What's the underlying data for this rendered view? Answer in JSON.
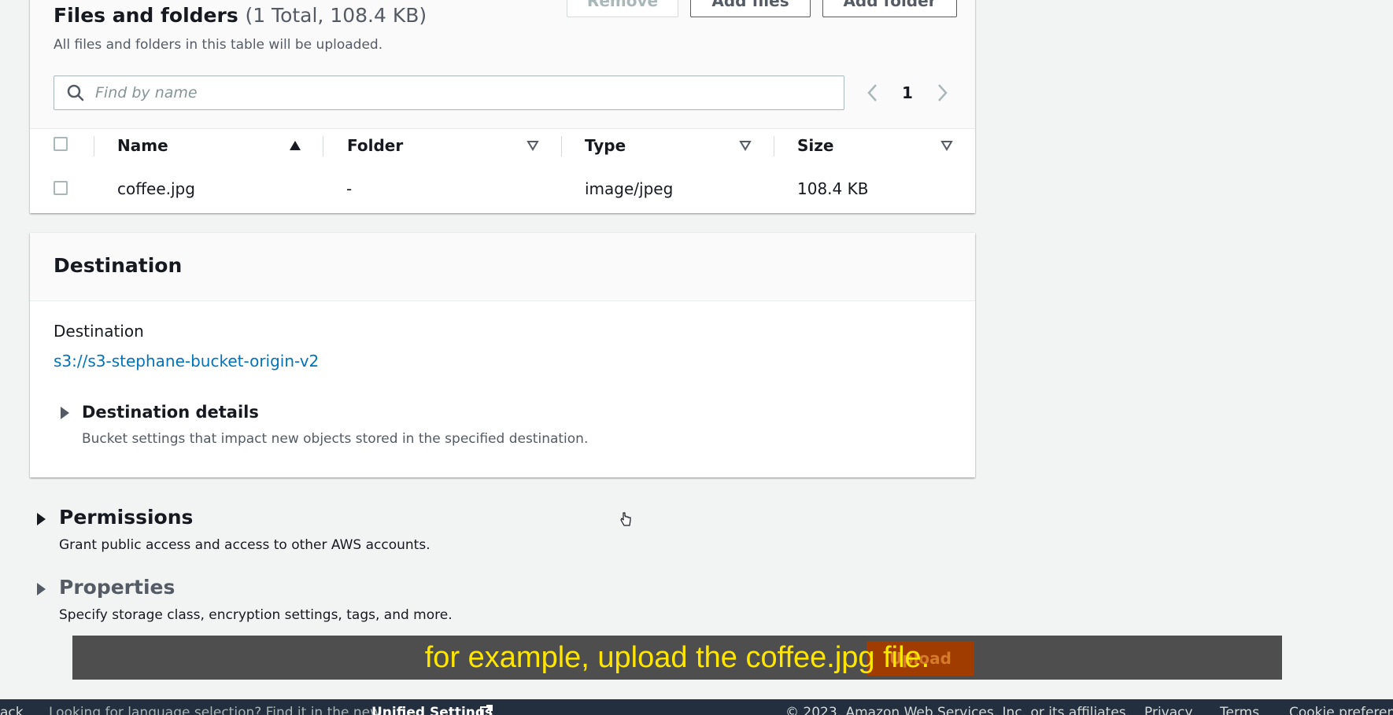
{
  "files": {
    "title": "Files and folders",
    "count": "(1 Total, 108.4 KB)",
    "description": "All files and folders in this table will be uploaded.",
    "buttons": {
      "remove": "Remove",
      "add_files": "Add files",
      "add_folder": "Add folder"
    },
    "search_placeholder": "Find by name",
    "page": "1",
    "columns": [
      "Name",
      "Folder",
      "Type",
      "Size"
    ],
    "rows": [
      {
        "name": "coffee.jpg",
        "folder": "-",
        "type": "image/jpeg",
        "size": "108.4 KB"
      }
    ]
  },
  "destination": {
    "title": "Destination",
    "label": "Destination",
    "uri": "s3://s3-stephane-bucket-origin-v2",
    "details_title": "Destination details",
    "details_desc": "Bucket settings that impact new objects stored in the specified destination."
  },
  "permissions": {
    "title": "Permissions",
    "desc": "Grant public access and access to other AWS accounts."
  },
  "properties": {
    "title": "Properties",
    "desc": "Specify storage class, encryption settings, tags, and more."
  },
  "upload_button": "Upload",
  "caption": "for example, upload the coffee.jpg file.",
  "footer": {
    "feedback": "ack",
    "language_note": "Looking for language selection? Find it in the new",
    "unified_settings": "Unified Settings",
    "copyright": "© 2023, Amazon Web Services, Inc. or its affiliates.",
    "privacy": "Privacy",
    "terms": "Terms",
    "cookie": "Cookie preferences"
  },
  "colors": {
    "link": "#0073bb",
    "caption_text": "#ffe600",
    "upload": "#a03c00",
    "footer_bg": "#232f3e"
  },
  "icons": [
    "search-icon",
    "chevron-left-icon",
    "chevron-right-icon",
    "sort-ascending-icon",
    "sort-descending-icon",
    "caret-right-icon",
    "external-link-icon",
    "hand-cursor-icon"
  ]
}
